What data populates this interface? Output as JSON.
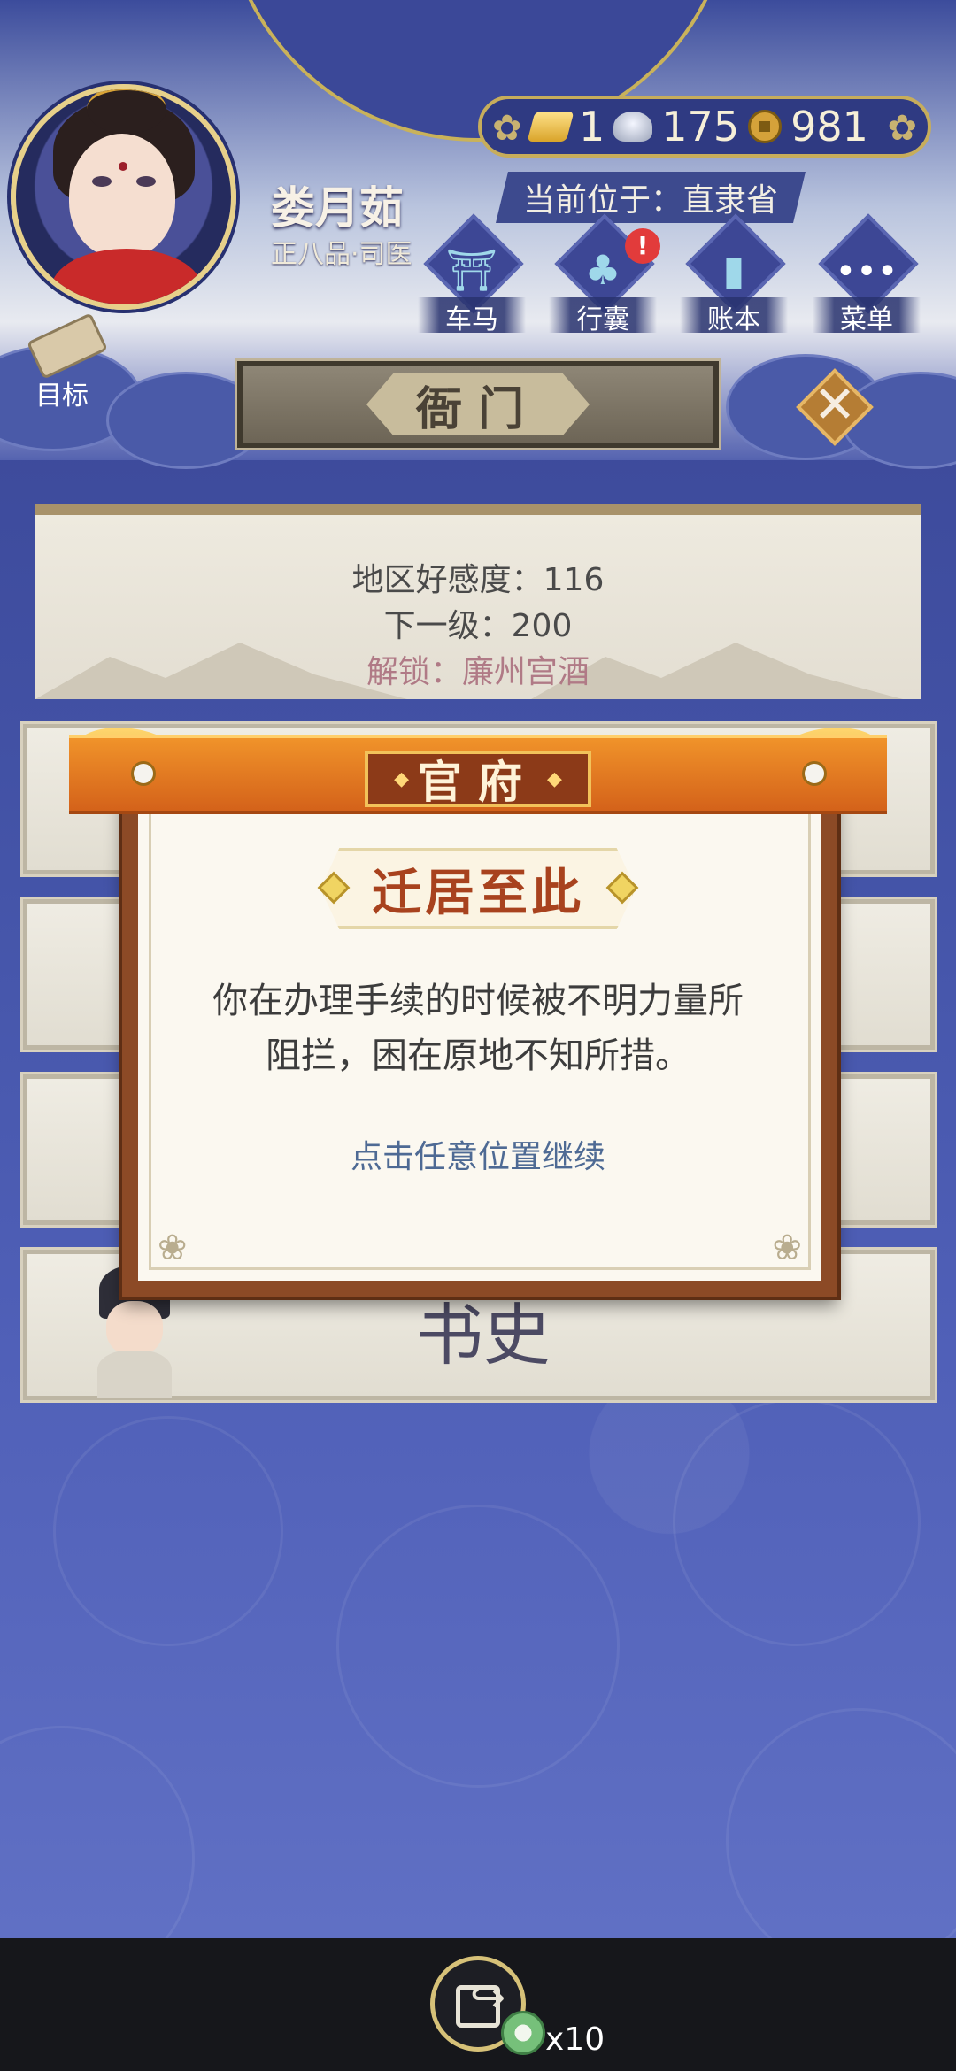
{
  "player": {
    "name": "娄月茹",
    "rank": "正八品·司医"
  },
  "currency": {
    "gold": "1",
    "silver": "175",
    "copper": "981"
  },
  "location": {
    "label": "当前位于：直隶省"
  },
  "top_menu": {
    "items": [
      {
        "label": "车马",
        "icon": "carriage-icon"
      },
      {
        "label": "行囊",
        "icon": "bag-icon",
        "badge": "!"
      },
      {
        "label": "账本",
        "icon": "ledger-icon"
      },
      {
        "label": "菜单",
        "icon": "more-icon",
        "glyph": "•••"
      }
    ]
  },
  "goal": {
    "label": "目标"
  },
  "page": {
    "title": "衙门"
  },
  "affinity": {
    "current": "地区好感度：116",
    "next": "下一级：200",
    "unlock": "解锁：廉州宫酒"
  },
  "list": {
    "last_row_title": "书史"
  },
  "dialog": {
    "header": "官府",
    "title": "迁居至此",
    "body_line1": "你在办理手续的时候被不明力量所",
    "body_line2": "阻拦，困在原地不知所措。",
    "hint": "点击任意位置继续"
  },
  "bottom": {
    "share_count": "x10"
  },
  "colors": {
    "header_orange": "#e07a22",
    "dialog_border": "#8c4a26",
    "title_red": "#a8421e",
    "hint_blue": "#4e6a94",
    "unlock_pink": "#b07a86"
  }
}
